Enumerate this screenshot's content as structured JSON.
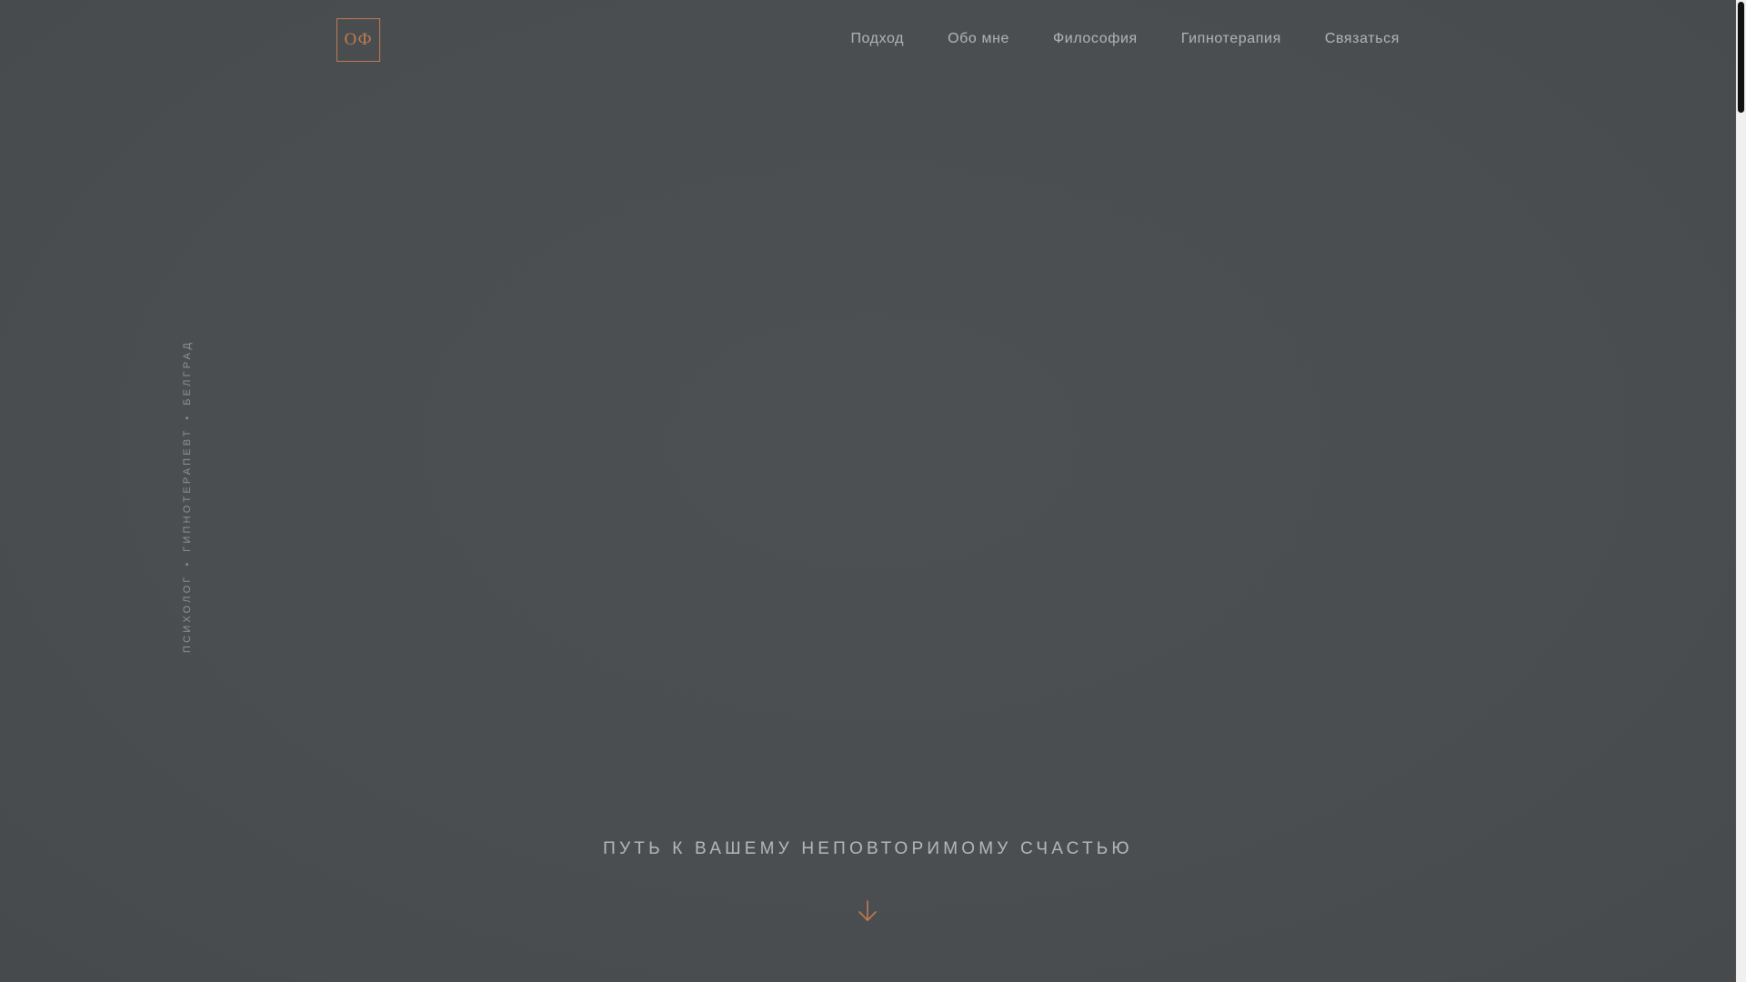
{
  "header": {
    "logo_text": "ОФ",
    "nav": [
      {
        "label": "Подход"
      },
      {
        "label": "Обо мне"
      },
      {
        "label": "Философия"
      },
      {
        "label": "Гипнотерапия"
      },
      {
        "label": "Связаться"
      }
    ]
  },
  "side": {
    "part1": "ПСИХОЛОГ",
    "part2": "ГИПНОТЕРАПЕВТ",
    "part3": "БЕЛГРАД",
    "separator": "•"
  },
  "hero": {
    "tagline": "ПУТЬ К ВАШЕМУ НЕПОВТОРИМОМУ СЧАСТЬЮ",
    "scroll_icon": "arrow-down-icon"
  },
  "colors": {
    "background": "#4a4e50",
    "accent": "#c07a52",
    "nav_text": "#b3b6b7"
  }
}
